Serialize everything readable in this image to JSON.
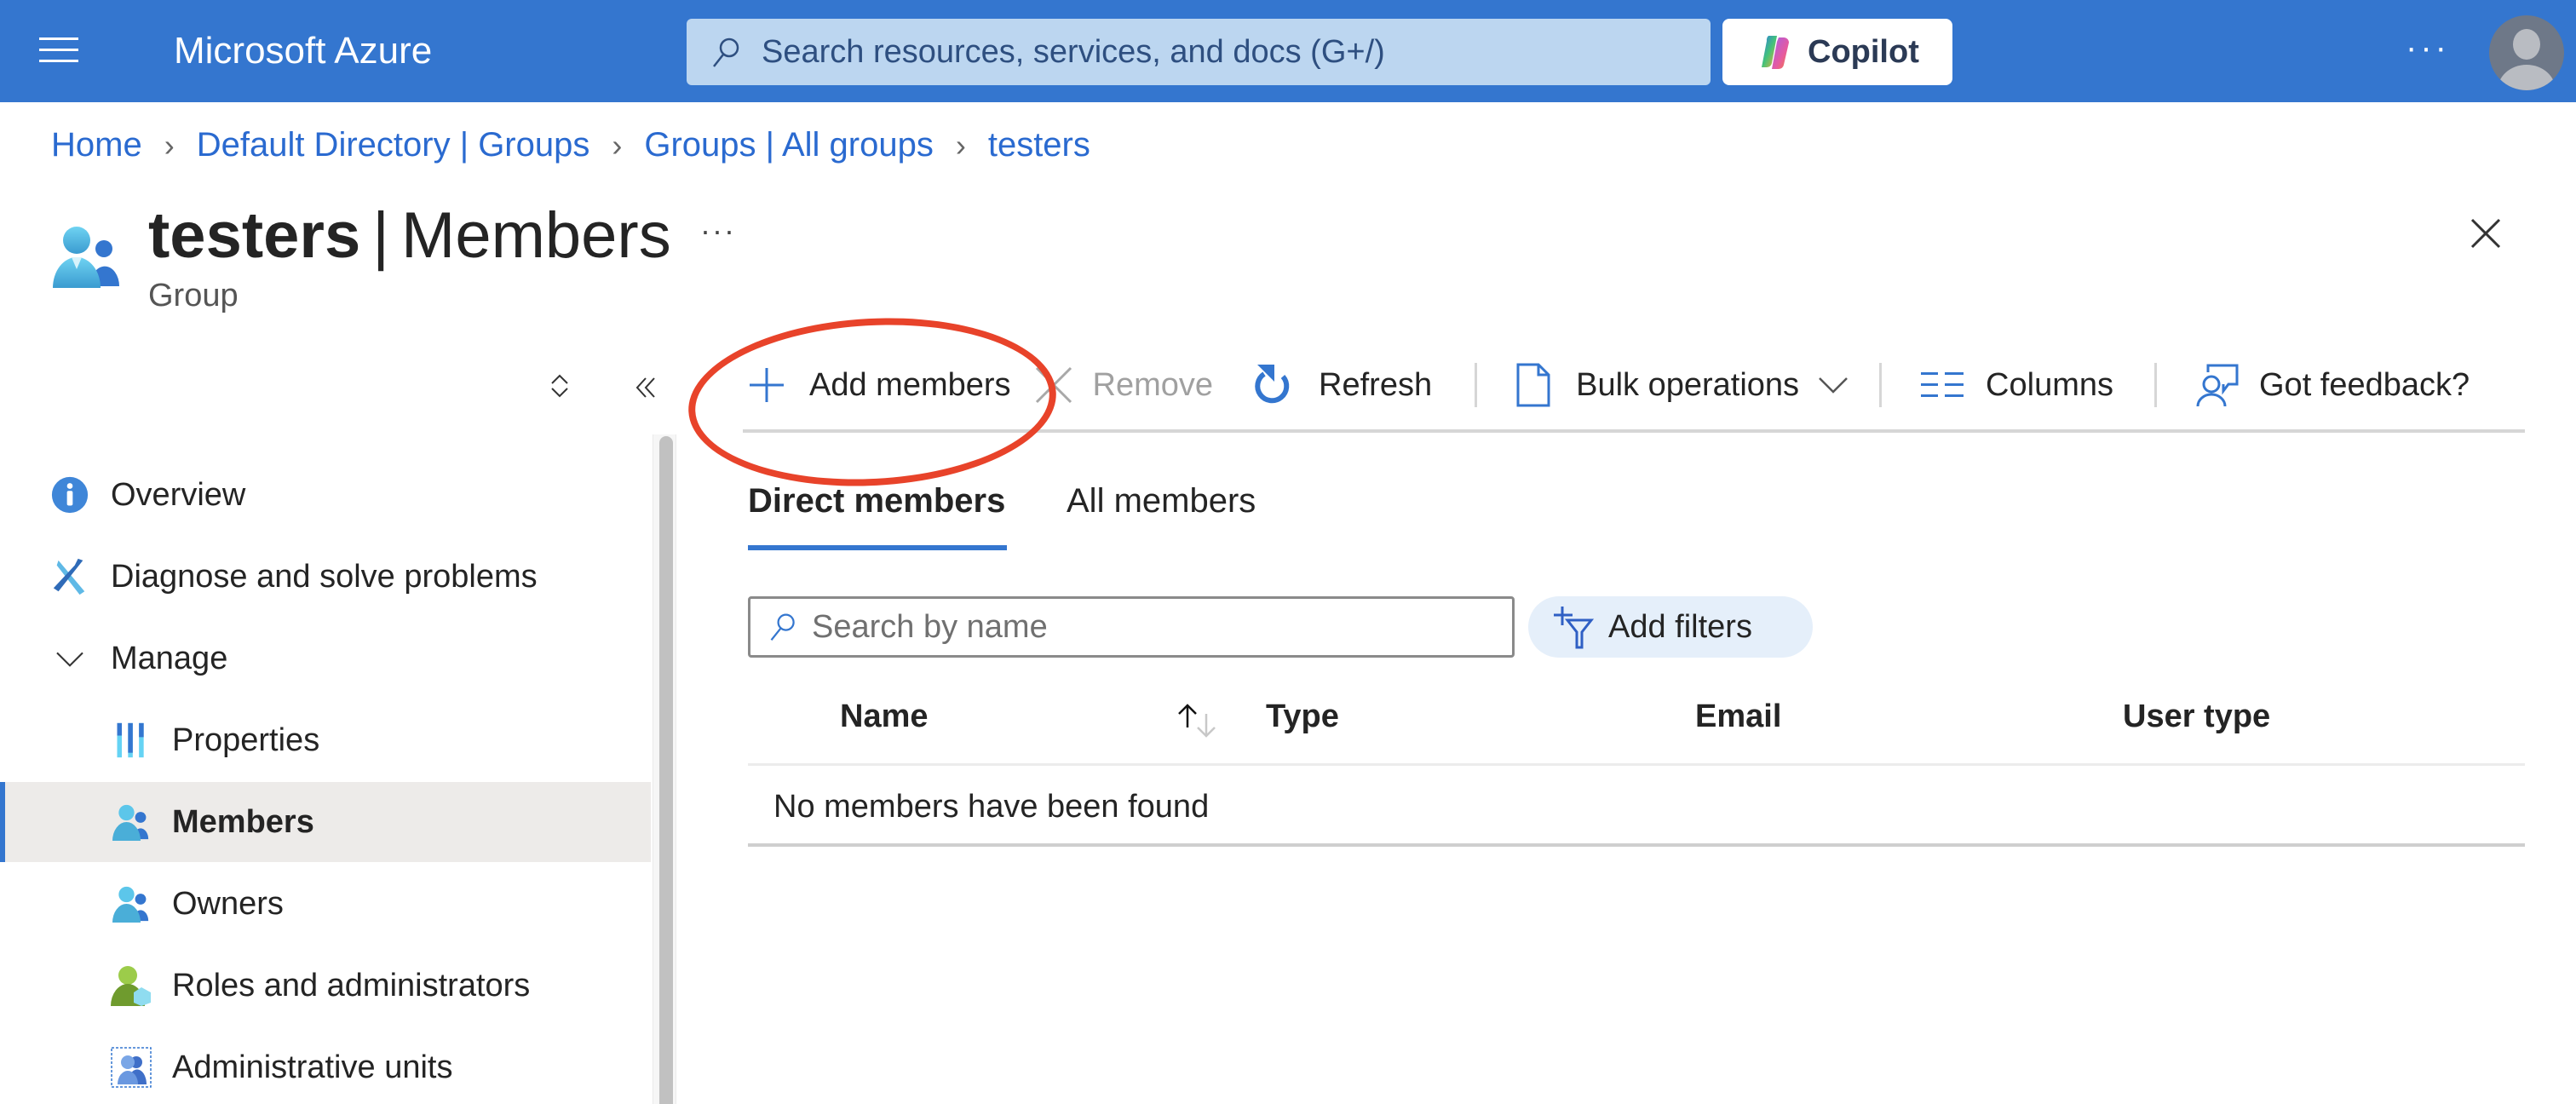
{
  "topbar": {
    "brand": "Microsoft Azure",
    "search_placeholder": "Search resources, services, and docs (G+/)",
    "copilot_label": "Copilot",
    "more_label": "···",
    "color": "#3476cf"
  },
  "breadcrumb": [
    {
      "label": "Home"
    },
    {
      "label": "Default Directory | Groups"
    },
    {
      "label": "Groups | All groups"
    },
    {
      "label": "testers"
    }
  ],
  "breadcrumb_sep": "›",
  "page": {
    "resource_name": "testers",
    "pipe": "|",
    "section": "Members",
    "subtitle": "Group",
    "more_label": "···"
  },
  "sidebar": {
    "items": [
      {
        "label": "Overview",
        "icon": "info-icon",
        "level": 0
      },
      {
        "label": "Diagnose and solve problems",
        "icon": "wrench-icon",
        "level": 0
      },
      {
        "label": "Manage",
        "icon": "chevron-down-icon",
        "level": 0
      },
      {
        "label": "Properties",
        "icon": "properties-icon",
        "level": 1
      },
      {
        "label": "Members",
        "icon": "members-icon",
        "level": 1,
        "active": true
      },
      {
        "label": "Owners",
        "icon": "owners-icon",
        "level": 1
      },
      {
        "label": "Roles and administrators",
        "icon": "roles-icon",
        "level": 1
      },
      {
        "label": "Administrative units",
        "icon": "admin-units-icon",
        "level": 1
      }
    ]
  },
  "commands": {
    "add_members": "Add members",
    "remove": "Remove",
    "refresh": "Refresh",
    "bulk_operations": "Bulk operations",
    "columns": "Columns",
    "feedback": "Got feedback?"
  },
  "tabs": [
    {
      "label": "Direct members",
      "active": true
    },
    {
      "label": "All members",
      "active": false
    }
  ],
  "search": {
    "placeholder": "Search by name",
    "value": ""
  },
  "filters": {
    "add_label": "Add filters"
  },
  "table": {
    "columns": [
      "Name",
      "Type",
      "Email",
      "User type"
    ],
    "sort": {
      "column": "Name",
      "direction": "ascending"
    },
    "rows": [],
    "empty_message": "No members have been found"
  },
  "annotation": {
    "highlight_target": "Add members",
    "color": "#e8432a"
  }
}
